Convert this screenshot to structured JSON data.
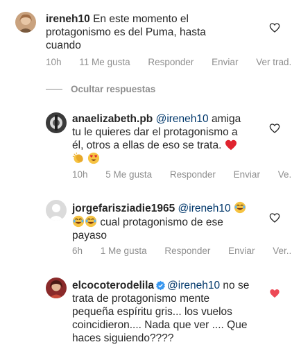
{
  "comments": [
    {
      "username": "ireneh10",
      "text_lines": [
        "En este momento el",
        "protagonismo es del Puma, hasta",
        "cuando"
      ],
      "time": "10h",
      "likes": "11 Me gusta",
      "reply": "Responder",
      "send": "Enviar",
      "translate": "Ver trad..."
    },
    {
      "username": "anaelizabeth.pb",
      "mention": "@ireneh10",
      "line1_rest": "amiga",
      "line2": "tu le quieres dar el protagonismo a",
      "line3": "él, otros a ellas de eso se trata.",
      "time": "10h",
      "likes": "5 Me gusta",
      "reply": "Responder",
      "send": "Enviar",
      "translate": "Ve..."
    },
    {
      "username": "jorgefarisziadie1965",
      "mention": "@ireneh10",
      "line2": "cual protagonismo de ese",
      "line3": "payaso",
      "time": "6h",
      "likes": "1 Me gusta",
      "reply": "Responder",
      "send": "Enviar",
      "translate": "Ver..."
    },
    {
      "username": "elcocoterodelila",
      "mention": "@ireneh10",
      "line1_rest": "no se",
      "line2": "trata de protagonismo mente",
      "line3": "pequeña espíritu gris... los vuelos",
      "line4": "coincidieron.... Nada que ver .... Que",
      "line5": "haces siguiendo????"
    }
  ],
  "hide_replies": "Ocultar respuestas",
  "colors": {
    "like_red": "#ed4956",
    "muted": "#8e8e8e",
    "mention": "#00376b",
    "text": "#262626"
  }
}
